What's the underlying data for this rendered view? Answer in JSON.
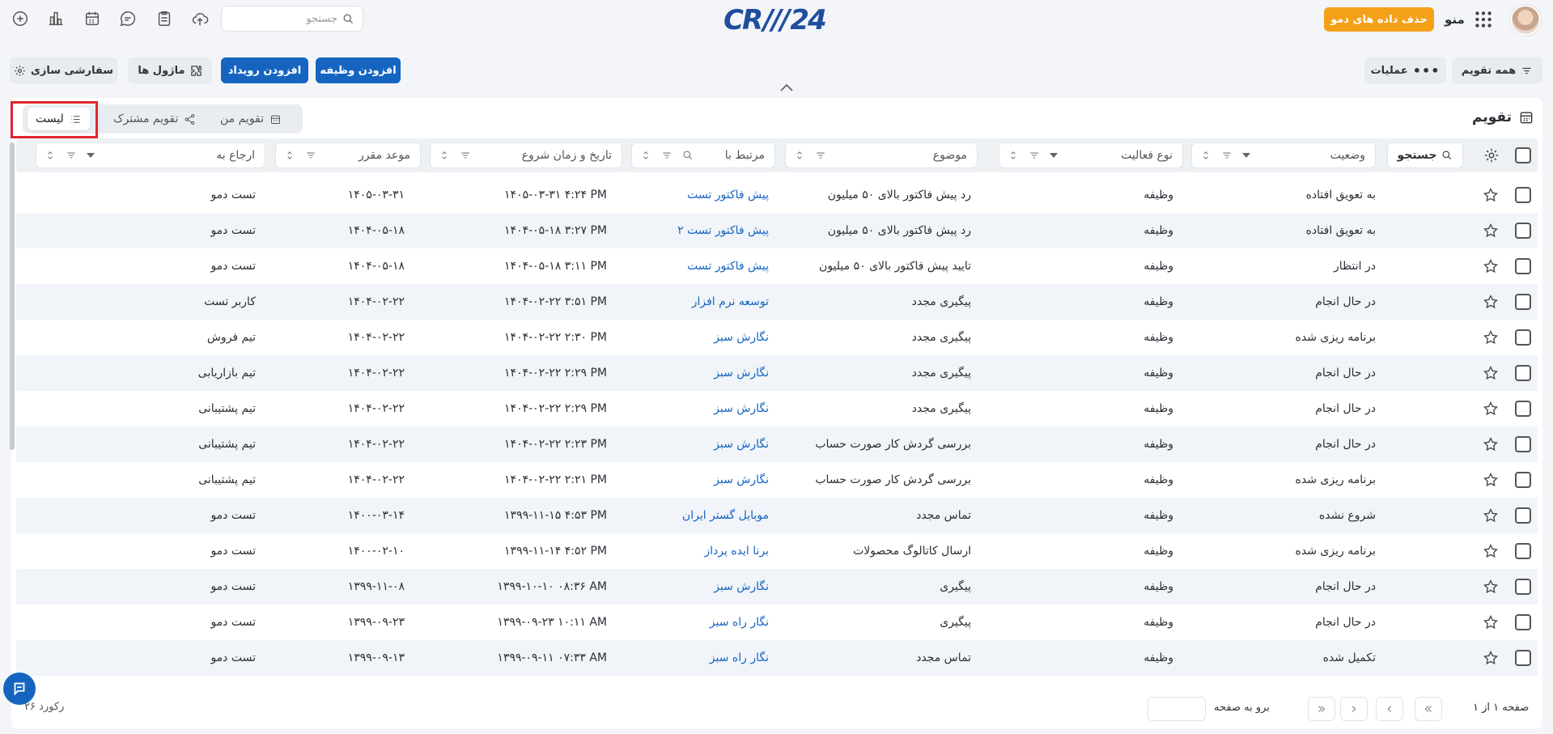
{
  "header": {
    "search_placeholder": "جستجو",
    "logo_text_left": "CR",
    "logo_slashes": "///",
    "logo_text_right": "24",
    "demo_button": "حذف داده های دمو",
    "menu_label": "منو"
  },
  "toolbar": {
    "customize": "سفارشی سازی",
    "modules": "ماژول ها",
    "add_event": "افزودن رویداد",
    "add_task": "افزودن وظیفه",
    "operations": "عملیات",
    "all_calendars": "همه تقویم"
  },
  "view_tabs": {
    "list": "لیست",
    "shared_calendar": "تقویم مشترک",
    "my_calendar": "تقویم من"
  },
  "panel_title": "تقویم",
  "columns": {
    "search": "جستجو",
    "status": "وضعیت",
    "activity_type": "نوع فعالیت",
    "subject": "موضوع",
    "related_to": "مرتبط با",
    "start_datetime": "تاریخ و زمان شروع",
    "due_date": "موعد مقرر",
    "assigned_to": "ارجاع به"
  },
  "rows": [
    {
      "status": "به تعویق افتاده",
      "type": "وظیفه",
      "subject": "رد پیش فاکتور بالای ۵۰ میلیون",
      "related": "پیش فاکتور تست",
      "start": "۱۴۰۵-۰۳-۳۱ ۴:۲۴ PM",
      "due": "۱۴۰۵-۰۳-۳۱",
      "assigned": "تست دمو"
    },
    {
      "status": "به تعویق افتاده",
      "type": "وظیفه",
      "subject": "رد پیش فاکتور بالای ۵۰ میلیون",
      "related": "پیش فاکتور تست ۲",
      "start": "۱۴۰۴-۰۵-۱۸ ۳:۲۷ PM",
      "due": "۱۴۰۴-۰۵-۱۸",
      "assigned": "تست دمو"
    },
    {
      "status": "در انتظار",
      "type": "وظیفه",
      "subject": "تایید پیش فاکتور بالای ۵۰ میلیون",
      "related": "پیش فاکتور تست",
      "start": "۱۴۰۴-۰۵-۱۸ ۳:۱۱ PM",
      "due": "۱۴۰۴-۰۵-۱۸",
      "assigned": "تست دمو"
    },
    {
      "status": "در حال انجام",
      "type": "وظیفه",
      "subject": "پیگیری مجدد",
      "related": "توسعه نرم افزار",
      "start": "۱۴۰۴-۰۲-۲۲ ۳:۵۱ PM",
      "due": "۱۴۰۴-۰۲-۲۲",
      "assigned": "کاربر تست"
    },
    {
      "status": "برنامه ریزی شده",
      "type": "وظیفه",
      "subject": "پیگیری مجدد",
      "related": "نگارش سبز",
      "start": "۱۴۰۴-۰۲-۲۲ ۲:۳۰ PM",
      "due": "۱۴۰۴-۰۲-۲۲",
      "assigned": "تیم فروش"
    },
    {
      "status": "در حال انجام",
      "type": "وظیفه",
      "subject": "پیگیری مجدد",
      "related": "نگارش سبز",
      "start": "۱۴۰۴-۰۲-۲۲ ۲:۲۹ PM",
      "due": "۱۴۰۴-۰۲-۲۲",
      "assigned": "تیم بازاریابی"
    },
    {
      "status": "در حال انجام",
      "type": "وظیفه",
      "subject": "پیگیری مجدد",
      "related": "نگارش سبز",
      "start": "۱۴۰۴-۰۲-۲۲ ۲:۲۹ PM",
      "due": "۱۴۰۴-۰۲-۲۲",
      "assigned": "تیم پشتیبانی"
    },
    {
      "status": "در حال انجام",
      "type": "وظیفه",
      "subject": "بررسی گردش کار صورت حساب",
      "related": "نگارش سبز",
      "start": "۱۴۰۴-۰۲-۲۲ ۲:۲۳ PM",
      "due": "۱۴۰۴-۰۲-۲۲",
      "assigned": "تیم پشتیبانی"
    },
    {
      "status": "برنامه ریزی شده",
      "type": "وظیفه",
      "subject": "بررسی گردش کار صورت حساب",
      "related": "نگارش سبز",
      "start": "۱۴۰۴-۰۲-۲۲ ۲:۲۱ PM",
      "due": "۱۴۰۴-۰۲-۲۲",
      "assigned": "تیم پشتیبانی"
    },
    {
      "status": "شروع نشده",
      "type": "وظیفه",
      "subject": "تماس مجدد",
      "related": "موبایل گستر ایران",
      "start": "۱۳۹۹-۱۱-۱۵ ۴:۵۳ PM",
      "due": "۱۴۰۰-۰۳-۱۴",
      "assigned": "تست دمو"
    },
    {
      "status": "برنامه ریزی شده",
      "type": "وظیفه",
      "subject": "ارسال کاتالوگ محصولات",
      "related": "برنا ایده پرداز",
      "start": "۱۳۹۹-۱۱-۱۴ ۴:۵۲ PM",
      "due": "۱۴۰۰-۰۲-۱۰",
      "assigned": "تست دمو"
    },
    {
      "status": "در حال انجام",
      "type": "وظیفه",
      "subject": "پیگیری",
      "related": "نگارش سبز",
      "start": "۱۳۹۹-۱۰-۱۰ ۰۸:۳۶ AM",
      "due": "۱۳۹۹-۱۱-۰۸",
      "assigned": "تست دمو"
    },
    {
      "status": "در حال انجام",
      "type": "وظیفه",
      "subject": "پیگیری",
      "related": "نگار راه سبز",
      "start": "۱۳۹۹-۰۹-۲۳ ۱۰:۱۱ AM",
      "due": "۱۳۹۹-۰۹-۲۳",
      "assigned": "تست دمو"
    },
    {
      "status": "تکمیل شده",
      "type": "وظیفه",
      "subject": "تماس مجدد",
      "related": "نگار راه سبز",
      "start": "۱۳۹۹-۰۹-۱۱ ۰۷:۳۳ AM",
      "due": "۱۳۹۹-۰۹-۱۳",
      "assigned": "تست دمو"
    }
  ],
  "footer": {
    "record_count": "۲۶ رکورد",
    "goto_label": "برو به صفحه",
    "page_info": "صفحه ۱ از ۱"
  },
  "colors": {
    "primary": "#1565c0",
    "demo_button": "#f4a117",
    "highlight": "#e0262d"
  }
}
